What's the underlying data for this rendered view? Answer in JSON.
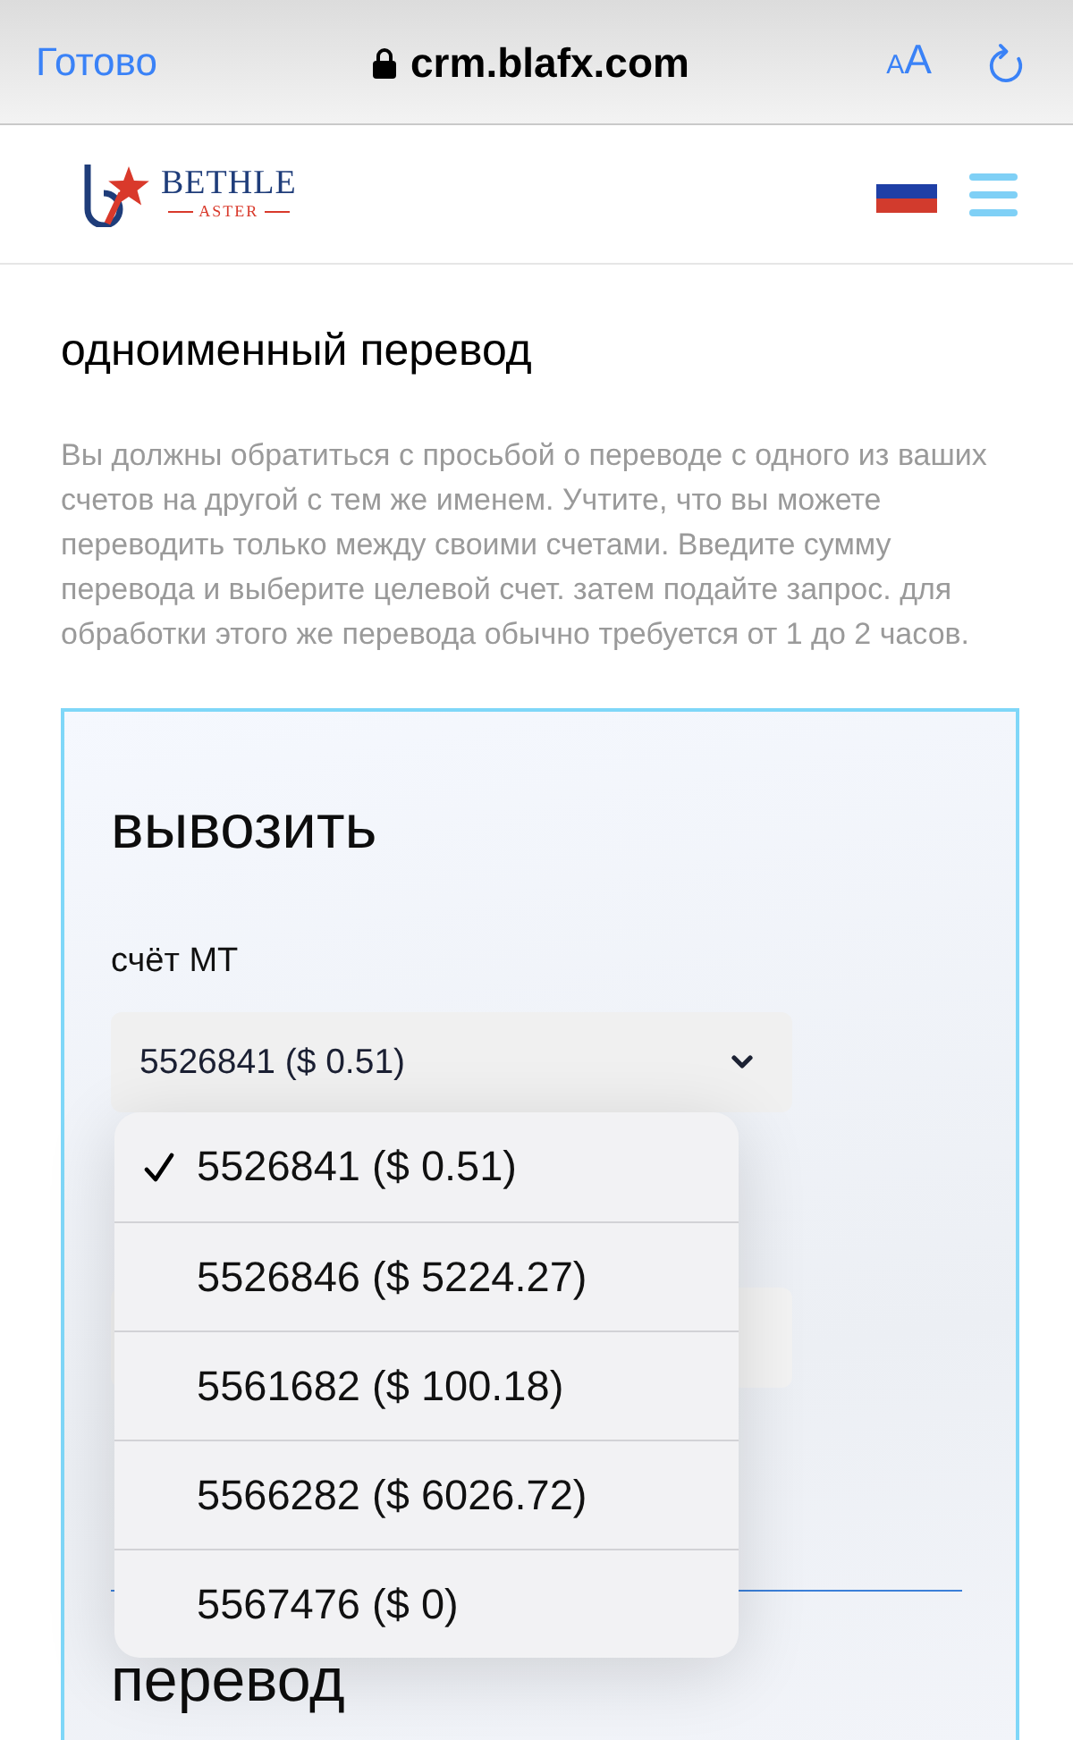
{
  "browser_bar": {
    "done_button": "Готово",
    "url": "crm.blafx.com",
    "text_size_button": "AA"
  },
  "site_header": {
    "logo": {
      "name": "BETHLE",
      "tagline": "ASTER"
    }
  },
  "intro": {
    "title": "одноименный перевод",
    "description": "Вы должны обратиться с просьбой о переводе с одного из ваших счетов на другой с тем же именем. Учтите, что вы можете переводить только между своими счетами. Введите сумму перевода и выберите целевой счет. затем подайте запрос. для обработки этого же перевода обычно требуется от 1 до 2 часов."
  },
  "withdraw_form": {
    "title": "вывозить",
    "account_label": "счёт МТ",
    "account_select": {
      "value": "5526841 ($ 0.51)",
      "expanded": true,
      "options": [
        {
          "label": "5526841 ($ 0.51)",
          "selected": true
        },
        {
          "label": "5526846 ($ 5224.27)",
          "selected": false
        },
        {
          "label": "5561682 ($ 100.18)",
          "selected": false
        },
        {
          "label": "5566282 ($ 6026.72)",
          "selected": false
        },
        {
          "label": "5567476 ($ 0)",
          "selected": false
        }
      ]
    },
    "next_section_title": "перевод"
  }
}
